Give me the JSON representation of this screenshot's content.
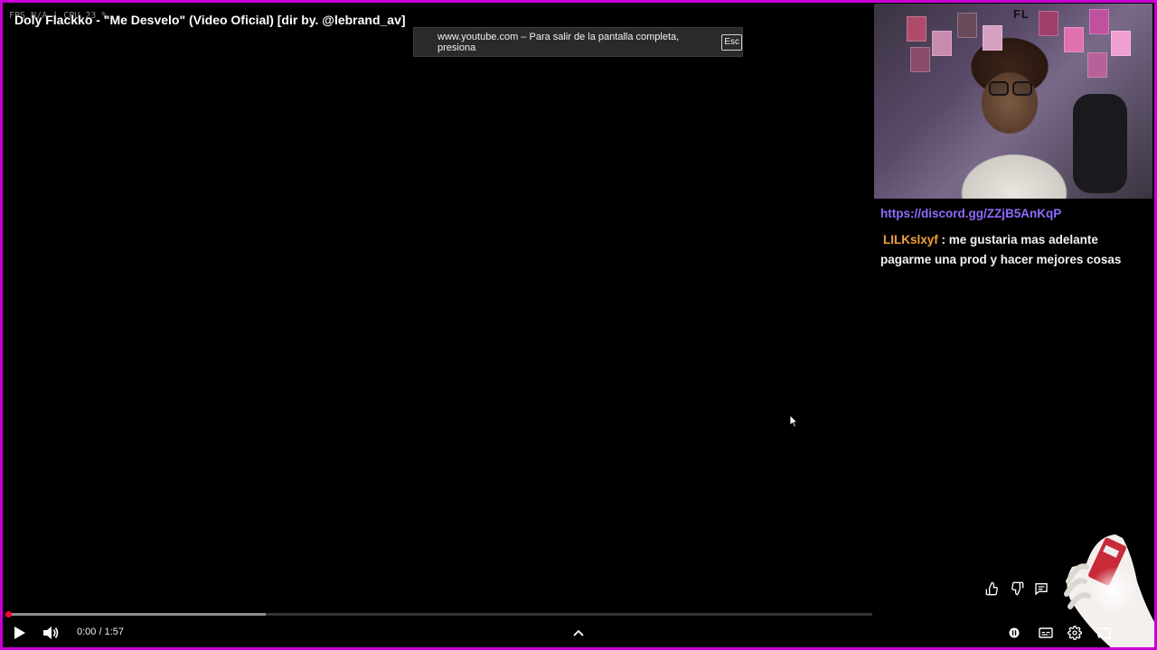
{
  "player": {
    "stats_overlay": "FPS N/A | CPU 23 %",
    "video_title": "Doly Flackko - \"Me Desvelo\" (Video Oficial) [dir by. @lebrand_av]",
    "fullscreen_notice": "www.youtube.com – Para salir de la pantalla completa, presiona",
    "esc_key": "Esc",
    "time_current": "0:00",
    "time_separator": " / ",
    "time_total": "1:57",
    "played_fraction": 0.0,
    "buffered_fraction": 0.3
  },
  "stream": {
    "webcam_logo": "FL",
    "chat_link": "https://discord.gg/ZZjB5AnKqP",
    "chat_username": "LILKslxyf",
    "chat_message": " : me gustaria mas adelante pagarme una prod y hacer mejores cosas"
  },
  "icons": {
    "play": "play-icon",
    "volume": "volume-icon",
    "expand": "chevron-up-icon",
    "autoplay": "autoplay-toggle-icon",
    "subtitles": "subtitles-icon",
    "settings": "settings-icon",
    "cast": "cast-icon",
    "like": "like-icon",
    "dislike": "dislike-icon",
    "comments": "comments-icon"
  },
  "colors": {
    "frame_border": "#c800d4",
    "progress_played": "#ff0033",
    "chat_link": "#8f6bff",
    "chat_username": "#f2a23a"
  }
}
